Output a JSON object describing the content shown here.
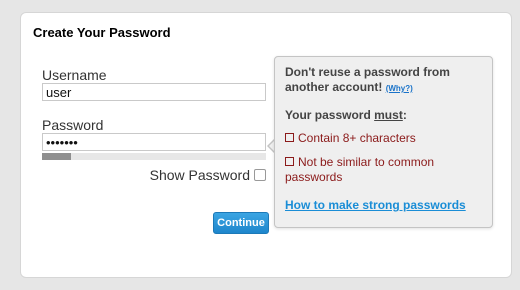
{
  "form": {
    "title": "Create Your Password",
    "username_label": "Username",
    "username_value": "user",
    "password_label": "Password",
    "password_value": "•••••••",
    "strength_fraction": 0.13,
    "show_password_label": "Show Password",
    "show_password_checked": false,
    "continue_label": "Continue"
  },
  "tooltip": {
    "heading": "Don't reuse a password from another account!",
    "why_link": "(Why?)",
    "must_prefix": "Your password ",
    "must_word": "must",
    "must_suffix": ":",
    "rules": [
      "Contain 8+ characters",
      "Not be similar to common passwords"
    ],
    "help_link": "How to make strong passwords"
  },
  "colors": {
    "accent": "#1a8dd6",
    "rule_text": "#8b1a1a",
    "button": "#1e86cc"
  }
}
